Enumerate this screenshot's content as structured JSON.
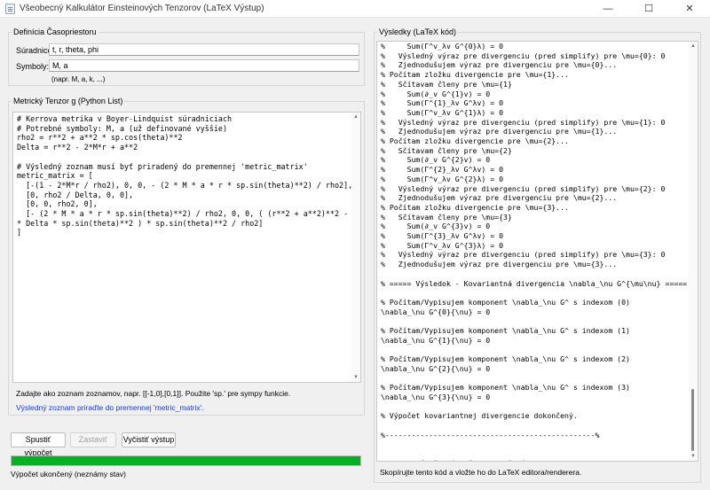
{
  "window": {
    "title": "Všeobecný Kalkulátor Einsteinových Tenzorov (LaTeX Výstup)",
    "min_glyph": "—",
    "max_glyph": "☐",
    "close_glyph": "✕"
  },
  "spacetime": {
    "legend": "Definícia Časopriestoru",
    "coords_label": "Súradnice:",
    "coords_value": "t, r, theta, phi",
    "symbols_label": "Symboly:",
    "symbols_value": "M, a",
    "symbols_hint": "(napr. M, a, k, ...)"
  },
  "metric": {
    "legend": "Metrický Tenzor g (Python List)",
    "code": "# Kerrova metrika v Boyer-Lindquist súradniciach\n# Potrebné symboly: M, a (už definované vyššie)\nrho2 = r**2 + a**2 * sp.cos(theta)**2\nDelta = r**2 - 2*M*r + a**2\n\n# Výsledný zoznam musí byť priradený do premennej 'metric_matrix'\nmetric_matrix = [\n  [-(1 - 2*M*r / rho2), 0, 0, - (2 * M * a * r * sp.sin(theta)**2) / rho2],\n  [0, rho2 / Delta, 0, 0],\n  [0, 0, rho2, 0],\n  [- (2 * M * a * r * sp.sin(theta)**2) / rho2, 0, 0, ( (r**2 + a**2)**2 - a**2\n* Delta * sp.sin(theta)**2 ) * sp.sin(theta)**2 / rho2]\n]",
    "hint1": "Zadajte ako zoznam zoznamov, napr. [[-1,0],[0,1]]. Použite 'sp.' pre sympy funkcie.",
    "hint2": "Výsledný zoznam priraďte do premennej 'metric_matrix'."
  },
  "buttons": {
    "run": "Spustiť výpočet",
    "stop": "Zastaviť",
    "clear": "Vyčistiť výstup"
  },
  "progress": {
    "fraction": 1.0,
    "status": "Výpočet ukončený (neznámy stav)"
  },
  "results": {
    "legend": "Výsledky (LaTeX kód)",
    "text": "%     Sum(Γ^v_λv G^{0}λ) = 0\n%   Výsledný výraz pre divergenciu (pred simplify) pre \\mu={0}: 0\n%   Zjednodušujem výraz pre divergenciu pre \\mu={0}...\n% Počítam zložku divergencie pre \\mu={1}...\n%   Sčítavam členy pre \\mu={1}\n%     Sum(∂_v G^{1}v) = 0\n%     Sum(Γ^{1}_λv G^λv) = 0\n%     Sum(Γ^v_λv G^{1}λ) = 0\n%   Výsledný výraz pre divergenciu (pred simplify) pre \\mu={1}: 0\n%   Zjednodušujem výraz pre divergenciu pre \\mu={1}...\n% Počítam zložku divergencie pre \\mu={2}...\n%   Sčítavam členy pre \\mu={2}\n%     Sum(∂_v G^{2}v) = 0\n%     Sum(Γ^{2}_λv G^λv) = 0\n%     Sum(Γ^v_λv G^{2}λ) = 0\n%   Výsledný výraz pre divergenciu (pred simplify) pre \\mu={2}: 0\n%   Zjednodušujem výraz pre divergenciu pre \\mu={2}...\n% Počítam zložku divergencie pre \\mu={3}...\n%   Sčítavam členy pre \\mu={3}\n%     Sum(∂_v G^{3}v) = 0\n%     Sum(Γ^{3}_λv G^λv) = 0\n%     Sum(Γ^v_λv G^{3}λ) = 0\n%   Výsledný výraz pre divergenciu (pred simplify) pre \\mu={3}: 0\n%   Zjednodušujem výraz pre divergenciu pre \\mu={3}...\n\n% ===== Výsledok - Kovariantná divergencia \\nabla_\\nu G^{\\mu\\nu} ===== %\n\n% Počítam/Vypisujem komponent \\nabla_\\nu G^ s indexom (0)\n\\nabla_\\nu G^{0}{\\nu} = 0\n\n% Počítam/Vypisujem komponent \\nabla_\\nu G^ s indexom (1)\n\\nabla_\\nu G^{1}{\\nu} = 0\n\n% Počítam/Vypisujem komponent \\nabla_\\nu G^ s indexom (2)\n\\nabla_\\nu G^{2}{\\nu} = 0\n\n% Počítam/Vypisujem komponent \\nabla_\\nu G^ s indexom (3)\n\\nabla_\\nu G^{3}{\\nu} = 0\n\n% Výpočet kovariantnej divergencie dokončený.\n\n%------------------------------------------------%\n\n\n% ===== Výpočet úspešne dokončený ===== %",
    "hint": "Skopírujte tento kód a vložte ho do LaTeX editora/renderera."
  }
}
